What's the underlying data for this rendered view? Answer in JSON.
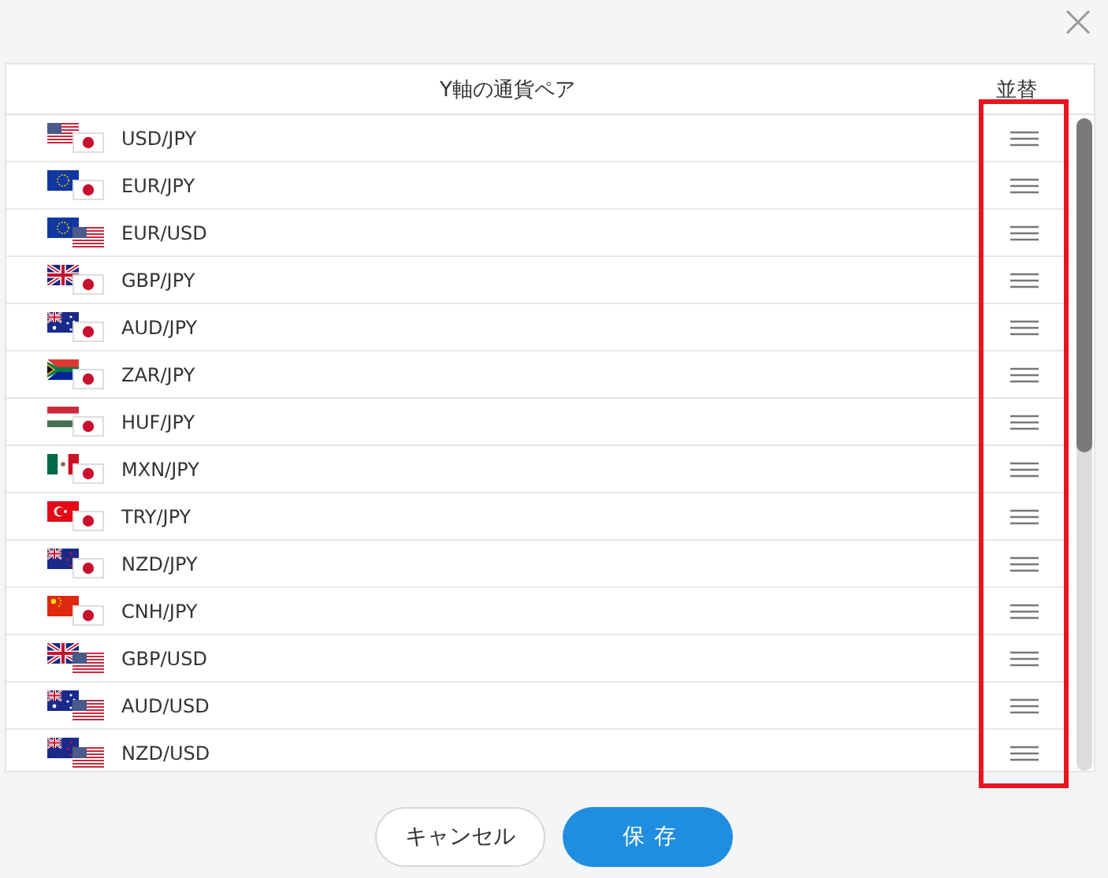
{
  "table": {
    "columns": [
      "Y軸の通貨ペア",
      "並替"
    ],
    "reorder_highlighted": true,
    "rows": [
      {
        "pair": "USD/JPY",
        "flags": [
          {
            "kind": "us"
          },
          {
            "kind": "jp"
          }
        ]
      },
      {
        "pair": "EUR/JPY",
        "flags": [
          {
            "kind": "eu"
          },
          {
            "kind": "jp"
          }
        ]
      },
      {
        "pair": "EUR/USD",
        "flags": [
          {
            "kind": "eu"
          },
          {
            "kind": "us"
          }
        ]
      },
      {
        "pair": "GBP/JPY",
        "flags": [
          {
            "kind": "gb"
          },
          {
            "kind": "jp"
          }
        ]
      },
      {
        "pair": "AUD/JPY",
        "flags": [
          {
            "kind": "au"
          },
          {
            "kind": "jp"
          }
        ]
      },
      {
        "pair": "ZAR/JPY",
        "flags": [
          {
            "kind": "za"
          },
          {
            "kind": "jp"
          }
        ]
      },
      {
        "pair": "HUF/JPY",
        "flags": [
          {
            "kind": "hu"
          },
          {
            "kind": "jp"
          }
        ]
      },
      {
        "pair": "MXN/JPY",
        "flags": [
          {
            "kind": "mx"
          },
          {
            "kind": "jp"
          }
        ]
      },
      {
        "pair": "TRY/JPY",
        "flags": [
          {
            "kind": "tr"
          },
          {
            "kind": "jp"
          }
        ]
      },
      {
        "pair": "NZD/JPY",
        "flags": [
          {
            "kind": "nz"
          },
          {
            "kind": "jp"
          }
        ]
      },
      {
        "pair": "CNH/JPY",
        "flags": [
          {
            "kind": "cn"
          },
          {
            "kind": "jp"
          }
        ]
      },
      {
        "pair": "GBP/USD",
        "flags": [
          {
            "kind": "gb"
          },
          {
            "kind": "us"
          }
        ]
      },
      {
        "pair": "AUD/USD",
        "flags": [
          {
            "kind": "au"
          },
          {
            "kind": "us"
          }
        ]
      },
      {
        "pair": "NZD/USD",
        "flags": [
          {
            "kind": "nz"
          },
          {
            "kind": "us"
          }
        ]
      }
    ]
  },
  "buttons": [
    {
      "label": "キャンセル",
      "kind": "secondary"
    },
    {
      "label": "保存",
      "kind": "primary"
    }
  ]
}
